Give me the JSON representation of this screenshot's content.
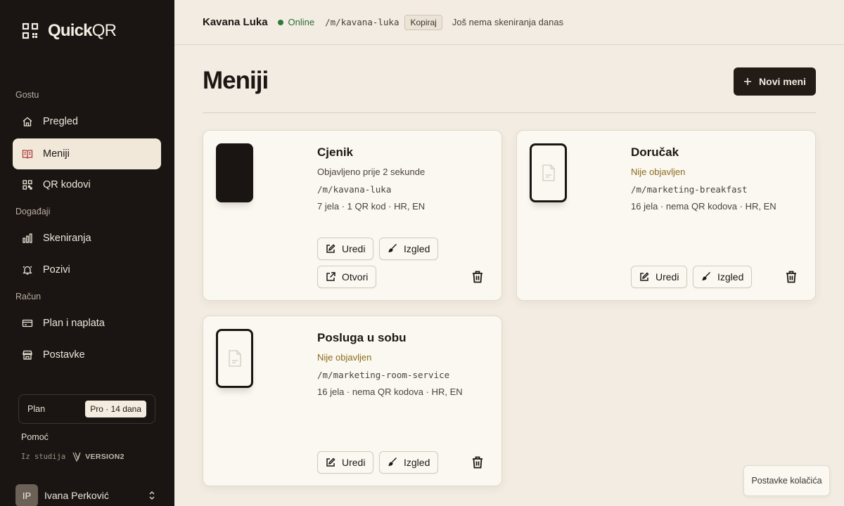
{
  "brand": {
    "name_bold": "Quick",
    "name_thin": "QR",
    "icon": "qr-grid-icon"
  },
  "sidebar": {
    "sections": [
      {
        "label": "Gostu"
      },
      {
        "label": "Događaji"
      },
      {
        "label": "Račun"
      }
    ],
    "items": [
      {
        "label": "Pregled",
        "icon": "home-icon",
        "active": false
      },
      {
        "label": "Meniji",
        "icon": "book-icon",
        "active": true
      },
      {
        "label": "QR kodovi",
        "icon": "qr-icon",
        "active": false
      },
      {
        "label": "Skeniranja",
        "icon": "bar-chart-icon",
        "active": false
      },
      {
        "label": "Pozivi",
        "icon": "bell-icon",
        "active": false
      },
      {
        "label": "Plan i naplata",
        "icon": "credit-card-icon",
        "active": false
      },
      {
        "label": "Postavke",
        "icon": "store-icon",
        "active": false
      }
    ],
    "plan": {
      "label": "Plan",
      "badge": "Pro · 14 dana"
    },
    "help": "Pomoć",
    "studio": {
      "prefix": "Iz studija",
      "logo": "VERSION2"
    },
    "user": {
      "initials": "IP",
      "name": "Ivana Perković"
    }
  },
  "topbar": {
    "venue": "Kavana Luka",
    "status": "Online",
    "slug": "/m/kavana-luka",
    "copy_label": "Kopiraj",
    "scan_note": "Još nema skeniranja danas"
  },
  "main": {
    "title": "Meniji",
    "new_button": "Novi meni",
    "cards": [
      {
        "title": "Cjenik",
        "status": "Objavljeno prije 2 sekunde",
        "published": true,
        "slug": "/m/kavana-luka",
        "meta": "7 jela · 1 QR kod · HR, EN",
        "buttons": [
          "Uredi",
          "Izgled",
          "Otvori"
        ]
      },
      {
        "title": "Doručak",
        "status": "Nije objavljen",
        "published": false,
        "slug": "/m/marketing-breakfast",
        "meta": "16 jela · nema QR kodova · HR, EN",
        "buttons": [
          "Uredi",
          "Izgled"
        ]
      },
      {
        "title": "Posluga u sobu",
        "status": "Nije objavljen",
        "published": false,
        "slug": "/m/marketing-room-service",
        "meta": "16 jela · nema QR kodova · HR, EN",
        "buttons": [
          "Uredi",
          "Izgled"
        ]
      }
    ]
  },
  "cookie_button": "Postavke kolačića",
  "colors": {
    "sidebar_bg": "#1a1513",
    "page_bg": "#f2ece2",
    "online": "#2f7a3a",
    "unpublished": "#8a6b1c"
  }
}
